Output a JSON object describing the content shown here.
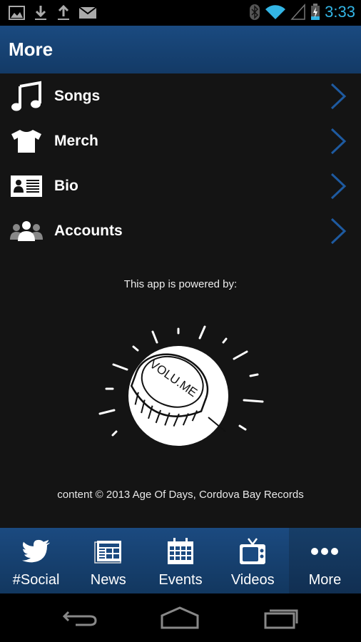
{
  "status_bar": {
    "left_icons": [
      "image-icon",
      "download-icon",
      "upload-icon",
      "mail-icon"
    ],
    "right_icons": [
      "bluetooth-icon",
      "wifi-icon",
      "signal-icon",
      "battery-charging-icon"
    ],
    "time": "3:33",
    "accent_color": "#33b5e5"
  },
  "app_bar": {
    "title": "More",
    "color": "#1a4a80"
  },
  "menu": {
    "items": [
      {
        "label": "Songs",
        "icon": "music-note-icon"
      },
      {
        "label": "Merch",
        "icon": "tshirt-icon"
      },
      {
        "label": "Bio",
        "icon": "id-card-icon"
      },
      {
        "label": "Accounts",
        "icon": "group-icon"
      }
    ],
    "chevron_color": "#1e5aa0"
  },
  "powered_by": {
    "label": "This app is powered by:",
    "logo_text": "VOLU.ME"
  },
  "footer": {
    "copyright": "content © 2013 Age Of Days, Cordova Bay Records"
  },
  "tab_bar": {
    "tabs": [
      {
        "label": "#Social",
        "icon": "twitter-bird-icon",
        "active": false
      },
      {
        "label": "News",
        "icon": "newspaper-icon",
        "active": false
      },
      {
        "label": "Events",
        "icon": "calendar-icon",
        "active": false
      },
      {
        "label": "Videos",
        "icon": "tv-icon",
        "active": false
      },
      {
        "label": "More",
        "icon": "more-dots-icon",
        "active": true
      }
    ]
  },
  "nav_bar": {
    "buttons": [
      "back-icon",
      "home-icon",
      "recent-apps-icon"
    ]
  }
}
